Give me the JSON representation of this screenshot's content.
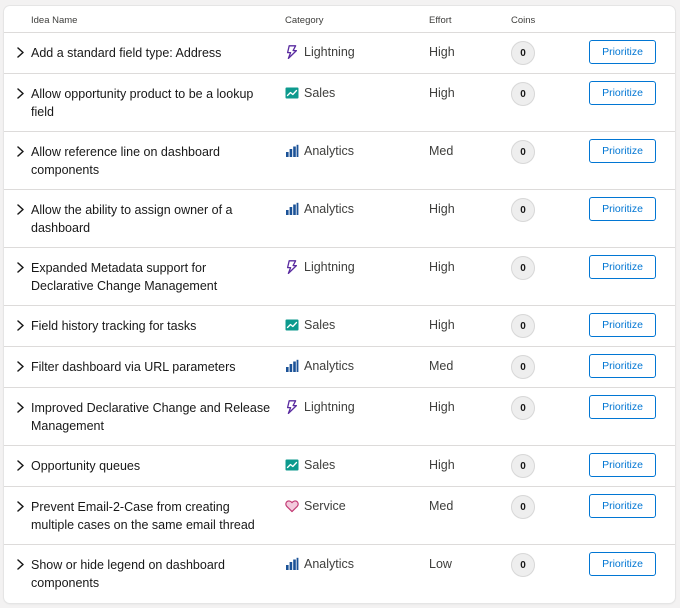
{
  "columns": {
    "name": "Idea Name",
    "category": "Category",
    "effort": "Effort",
    "coins": "Coins"
  },
  "button_label": "Prioritize",
  "category_styles": {
    "Lightning": {
      "icon": "lightning-icon",
      "color": "#5a2ca0"
    },
    "Sales": {
      "icon": "sales-chart-icon",
      "color": "#0d9a8e"
    },
    "Analytics": {
      "icon": "analytics-bar-icon",
      "color": "#1b5297"
    },
    "Service": {
      "icon": "heart-icon",
      "color": "#c23b74"
    }
  },
  "ideas": [
    {
      "name": "Add a standard field type: Address",
      "category": "Lightning",
      "effort": "High",
      "coins": "0",
      "lines": 1
    },
    {
      "name": "Allow opportunity product to be a lookup field",
      "category": "Sales",
      "effort": "High",
      "coins": "0",
      "lines": 2
    },
    {
      "name": "Allow reference line on dashboard components",
      "category": "Analytics",
      "effort": "Med",
      "coins": "0",
      "lines": 2
    },
    {
      "name": "Allow the ability to assign owner of a dashboard",
      "category": "Analytics",
      "effort": "High",
      "coins": "0",
      "lines": 2
    },
    {
      "name": "Expanded Metadata support for Declarative Change Management",
      "category": "Lightning",
      "effort": "High",
      "coins": "0",
      "lines": 2
    },
    {
      "name": "Field history tracking for tasks",
      "category": "Sales",
      "effort": "High",
      "coins": "0",
      "lines": 1
    },
    {
      "name": "Filter dashboard via URL parameters",
      "category": "Analytics",
      "effort": "Med",
      "coins": "0",
      "lines": 1
    },
    {
      "name": "Improved Declarative Change and Release Management",
      "category": "Lightning",
      "effort": "High",
      "coins": "0",
      "lines": 2
    },
    {
      "name": "Opportunity queues",
      "category": "Sales",
      "effort": "High",
      "coins": "0",
      "lines": 1
    },
    {
      "name": "Prevent Email-2-Case from creating multiple cases on the same email thread",
      "category": "Service",
      "effort": "Med",
      "coins": "0",
      "lines": 2
    },
    {
      "name": "Show or hide legend on dashboard components",
      "category": "Analytics",
      "effort": "Low",
      "coins": "0",
      "lines": 2
    }
  ]
}
